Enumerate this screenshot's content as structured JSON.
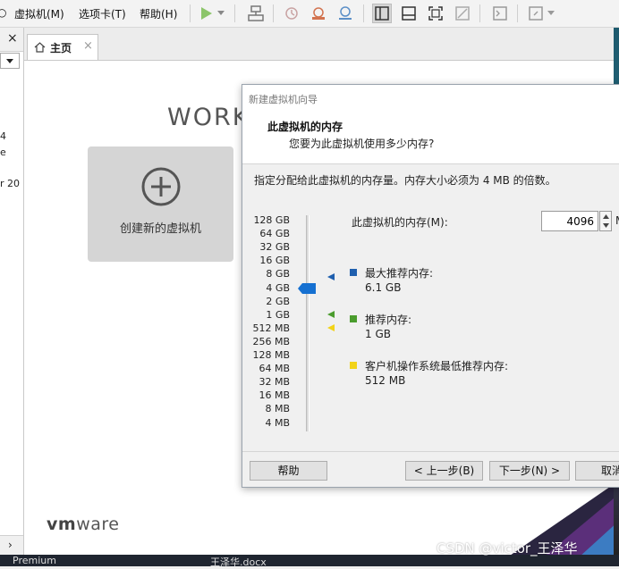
{
  "menubar": {
    "items": [
      "虚拟机(M)",
      "选项卡(T)",
      "帮助(H)"
    ]
  },
  "toolbar": {
    "icons": [
      "play-icon",
      "dropdown-icon",
      "network-icon",
      "snapshot-revert-icon",
      "snapshot-take-icon",
      "snapshot-manager-icon",
      "view-library-icon",
      "view-console-icon",
      "fullscreen-icon",
      "unity-icon",
      "terminal-icon",
      "stretch-icon"
    ]
  },
  "library": {
    "close_glyph": "×",
    "fragments": [
      "4",
      "e",
      "r 20"
    ]
  },
  "tabs": [
    {
      "label": "主页",
      "close": "×"
    }
  ],
  "home": {
    "work_title": "WORK",
    "create_label": "创建新的虚拟机",
    "logo_vm": "vm",
    "logo_ware": "ware"
  },
  "taskbar": {
    "items": [
      "Premium",
      "王泽华.docx"
    ]
  },
  "watermark": "CSDN @victor_王泽华",
  "dialog": {
    "title": "新建虚拟机向导",
    "heading": "此虚拟机的内存",
    "subheading": "您要为此虚拟机使用多少内存?",
    "intro": "指定分配给此虚拟机的内存量。内存大小必须为 4 MB 的倍数。",
    "memory_scale": [
      "128 GB",
      "64 GB",
      "32 GB",
      "16 GB",
      "8 GB",
      "4 GB",
      "2 GB",
      "1 GB",
      "512 MB",
      "256 MB",
      "128 MB",
      "64 MB",
      "32 MB",
      "16 MB",
      "8 MB",
      "4 MB"
    ],
    "selected_scale_index": 5,
    "memory_label": "此虚拟机的内存(M):",
    "memory_value": "4096",
    "memory_unit": "M",
    "legend": [
      {
        "title": "最大推荐内存:",
        "value": "6.1 GB",
        "color": "#1f5fae"
      },
      {
        "title": "推荐内存:",
        "value": "1 GB",
        "color": "#4a9c2d"
      },
      {
        "title": "客户机操作系统最低推荐内存:",
        "value": "512 MB",
        "color": "#f2d319"
      }
    ],
    "buttons": {
      "help": "帮助",
      "back": "< 上一步(B)",
      "next": "下一步(N) >",
      "cancel": "取消"
    }
  }
}
